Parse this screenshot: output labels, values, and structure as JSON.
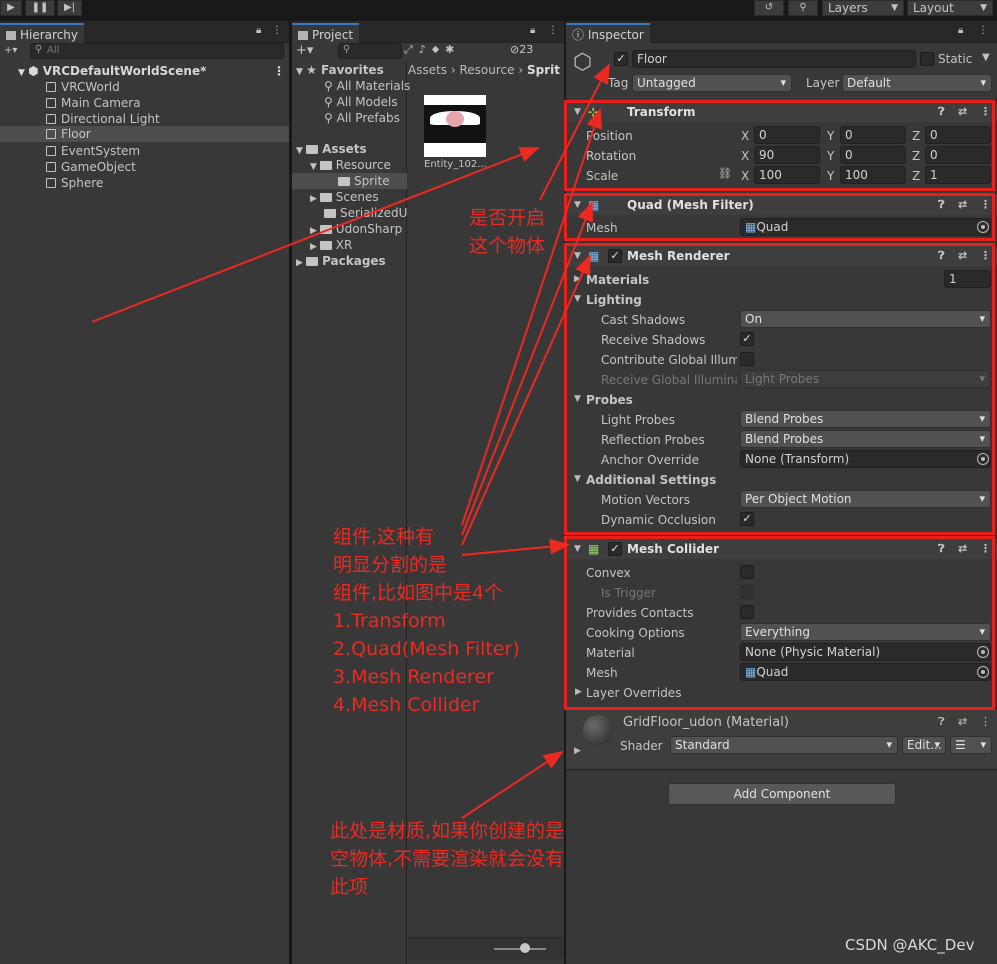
{
  "topbar": {
    "layers": "Layers",
    "layout": "Layout"
  },
  "hierarchy": {
    "tab": "Hierarchy",
    "search_placeholder": "All",
    "scene": "VRCDefaultWorldScene*",
    "items": [
      "VRCWorld",
      "Main Camera",
      "Directional Light",
      "Floor",
      "EventSystem",
      "GameObject",
      "Sphere"
    ]
  },
  "project": {
    "tab": "Project",
    "hidden_count": "23",
    "favorites": {
      "label": "Favorites",
      "items": [
        "All Materials",
        "All Models",
        "All Prefabs"
      ]
    },
    "assets": {
      "label": "Assets",
      "items": [
        "Resource",
        "Sprite",
        "Scenes",
        "SerializedU",
        "UdonSharp",
        "XR"
      ]
    },
    "packages": "Packages",
    "breadcrumb": [
      "Assets",
      "Resource",
      "Sprit"
    ],
    "thumb_label": "Entity_102..."
  },
  "inspector": {
    "tab": "Inspector",
    "object_name": "Floor",
    "static_label": "Static",
    "tag_label": "Tag",
    "tag_value": "Untagged",
    "layer_label": "Layer",
    "layer_value": "Default",
    "transform": {
      "title": "Transform",
      "position": {
        "label": "Position",
        "x": "0",
        "y": "0",
        "z": "0"
      },
      "rotation": {
        "label": "Rotation",
        "x": "90",
        "y": "0",
        "z": "0"
      },
      "scale": {
        "label": "Scale",
        "x": "100",
        "y": "100",
        "z": "1"
      },
      "axes": [
        "X",
        "Y",
        "Z"
      ]
    },
    "mesh_filter": {
      "title": "Quad (Mesh Filter)",
      "mesh_label": "Mesh",
      "mesh_value": "Quad"
    },
    "mesh_renderer": {
      "title": "Mesh Renderer",
      "materials_label": "Materials",
      "materials_count": "1",
      "lighting": "Lighting",
      "cast_shadows": {
        "label": "Cast Shadows",
        "value": "On"
      },
      "receive_shadows": "Receive Shadows",
      "contribute_gi": "Contribute Global Illumin",
      "receive_gi": {
        "label": "Receive Global Illuminati",
        "value": "Light Probes"
      },
      "probes": "Probes",
      "light_probes": {
        "label": "Light Probes",
        "value": "Blend Probes"
      },
      "reflection_probes": {
        "label": "Reflection Probes",
        "value": "Blend Probes"
      },
      "anchor_override": {
        "label": "Anchor Override",
        "value": "None (Transform)"
      },
      "additional": "Additional Settings",
      "motion_vectors": {
        "label": "Motion Vectors",
        "value": "Per Object Motion"
      },
      "dynamic_occlusion": "Dynamic Occlusion"
    },
    "mesh_collider": {
      "title": "Mesh Collider",
      "convex": "Convex",
      "is_trigger": "Is Trigger",
      "provides_contacts": "Provides Contacts",
      "cooking": {
        "label": "Cooking Options",
        "value": "Everything"
      },
      "material": {
        "label": "Material",
        "value": "None (Physic Material)"
      },
      "mesh": {
        "label": "Mesh",
        "value": "Quad"
      },
      "layer_overrides": "Layer Overrides"
    },
    "material": {
      "name": "GridFloor_udon (Material)",
      "shader_label": "Shader",
      "shader_value": "Standard",
      "edit": "Edit..."
    },
    "add_component": "Add Component"
  },
  "annotations": {
    "enable": [
      "是否开启",
      "这个物体"
    ],
    "components": [
      "组件,这种有",
      "明显分割的是",
      "组件,比如图中是4个",
      "1.Transform",
      "2.Quad(Mesh Filter)",
      "3.Mesh Renderer",
      "4.Mesh Collider"
    ],
    "material": [
      "此处是材质,如果你创建的是",
      "空物体,不需要渲染就会没有",
      "此项"
    ]
  },
  "watermark": "CSDN @AKC_Dev"
}
